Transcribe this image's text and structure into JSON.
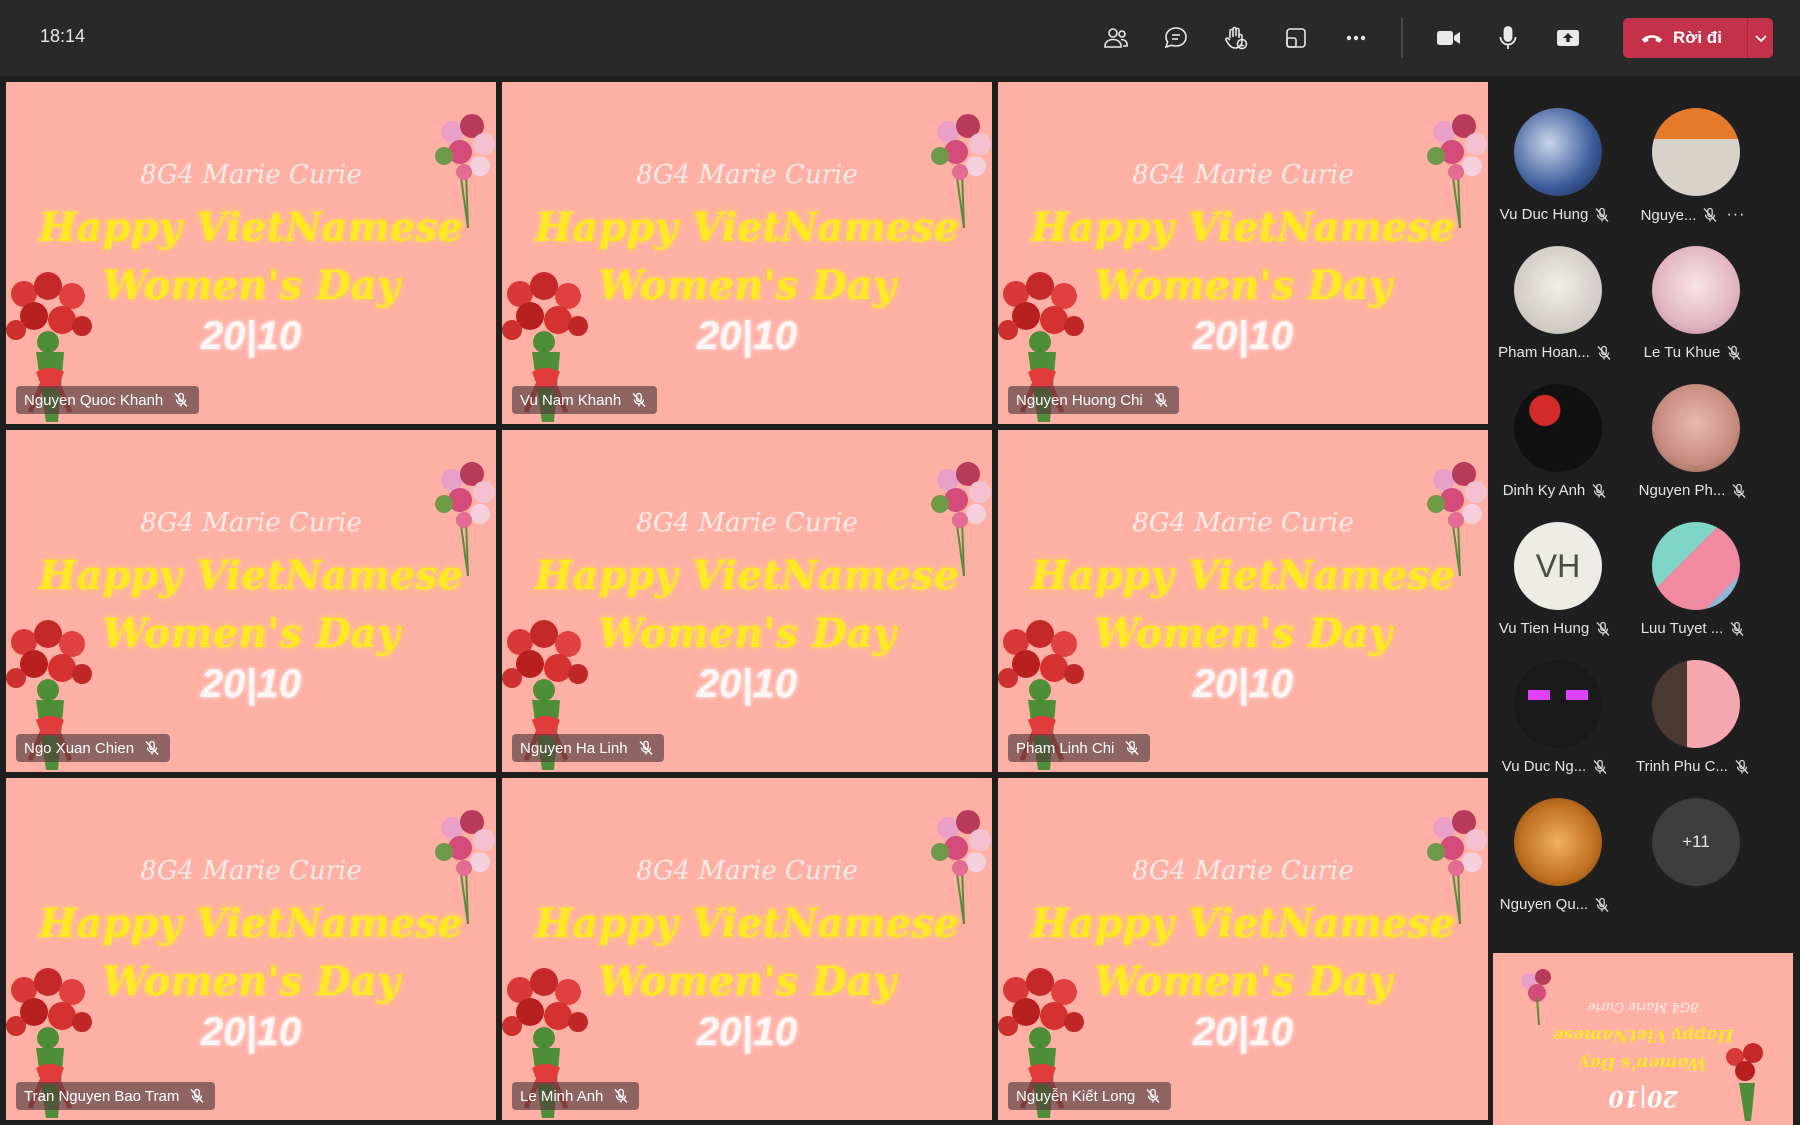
{
  "topbar": {
    "time": "18:14",
    "leave_label": "Rời đi",
    "buttons": [
      "people-icon",
      "chat-icon",
      "raise-hand-icon",
      "view-icon",
      "more-icon",
      "camera-icon",
      "mic-icon",
      "share-icon"
    ]
  },
  "slide": {
    "class_title": "8G4 Marie Curie",
    "line1": "Happy VietNamese",
    "line2": "Women's Day",
    "date": "20|10"
  },
  "tiles": [
    {
      "name": "Nguyen Quoc Khanh"
    },
    {
      "name": "Vu Nam Khanh"
    },
    {
      "name": "Nguyen Huong Chi"
    },
    {
      "name": "Ngo Xuan Chien"
    },
    {
      "name": "Nguyen Ha Linh"
    },
    {
      "name": "Pham Linh Chi"
    },
    {
      "name": "Tran Nguyen Bao Tram"
    },
    {
      "name": "Le Minh Anh"
    },
    {
      "name": "Nguyễn Kiết Long"
    }
  ],
  "panel": {
    "participants": [
      {
        "name": "Vu Duc Hung"
      },
      {
        "name": "Nguye..."
      },
      {
        "name": "Pham Hoan..."
      },
      {
        "name": "Le Tu Khue"
      },
      {
        "name": "Dinh Ky Anh"
      },
      {
        "name": "Nguyen Ph..."
      },
      {
        "name": "Vu Tien Hung",
        "initials": "VH"
      },
      {
        "name": "Luu Tuyet ..."
      },
      {
        "name": "Vu Duc Ng..."
      },
      {
        "name": "Trinh Phu C..."
      },
      {
        "name": "Nguyen Qu..."
      }
    ],
    "more_count": "+11"
  },
  "colors": {
    "leave": "#c4314b",
    "slide_bg": "#ffb0a5",
    "topbar": "#292929"
  }
}
